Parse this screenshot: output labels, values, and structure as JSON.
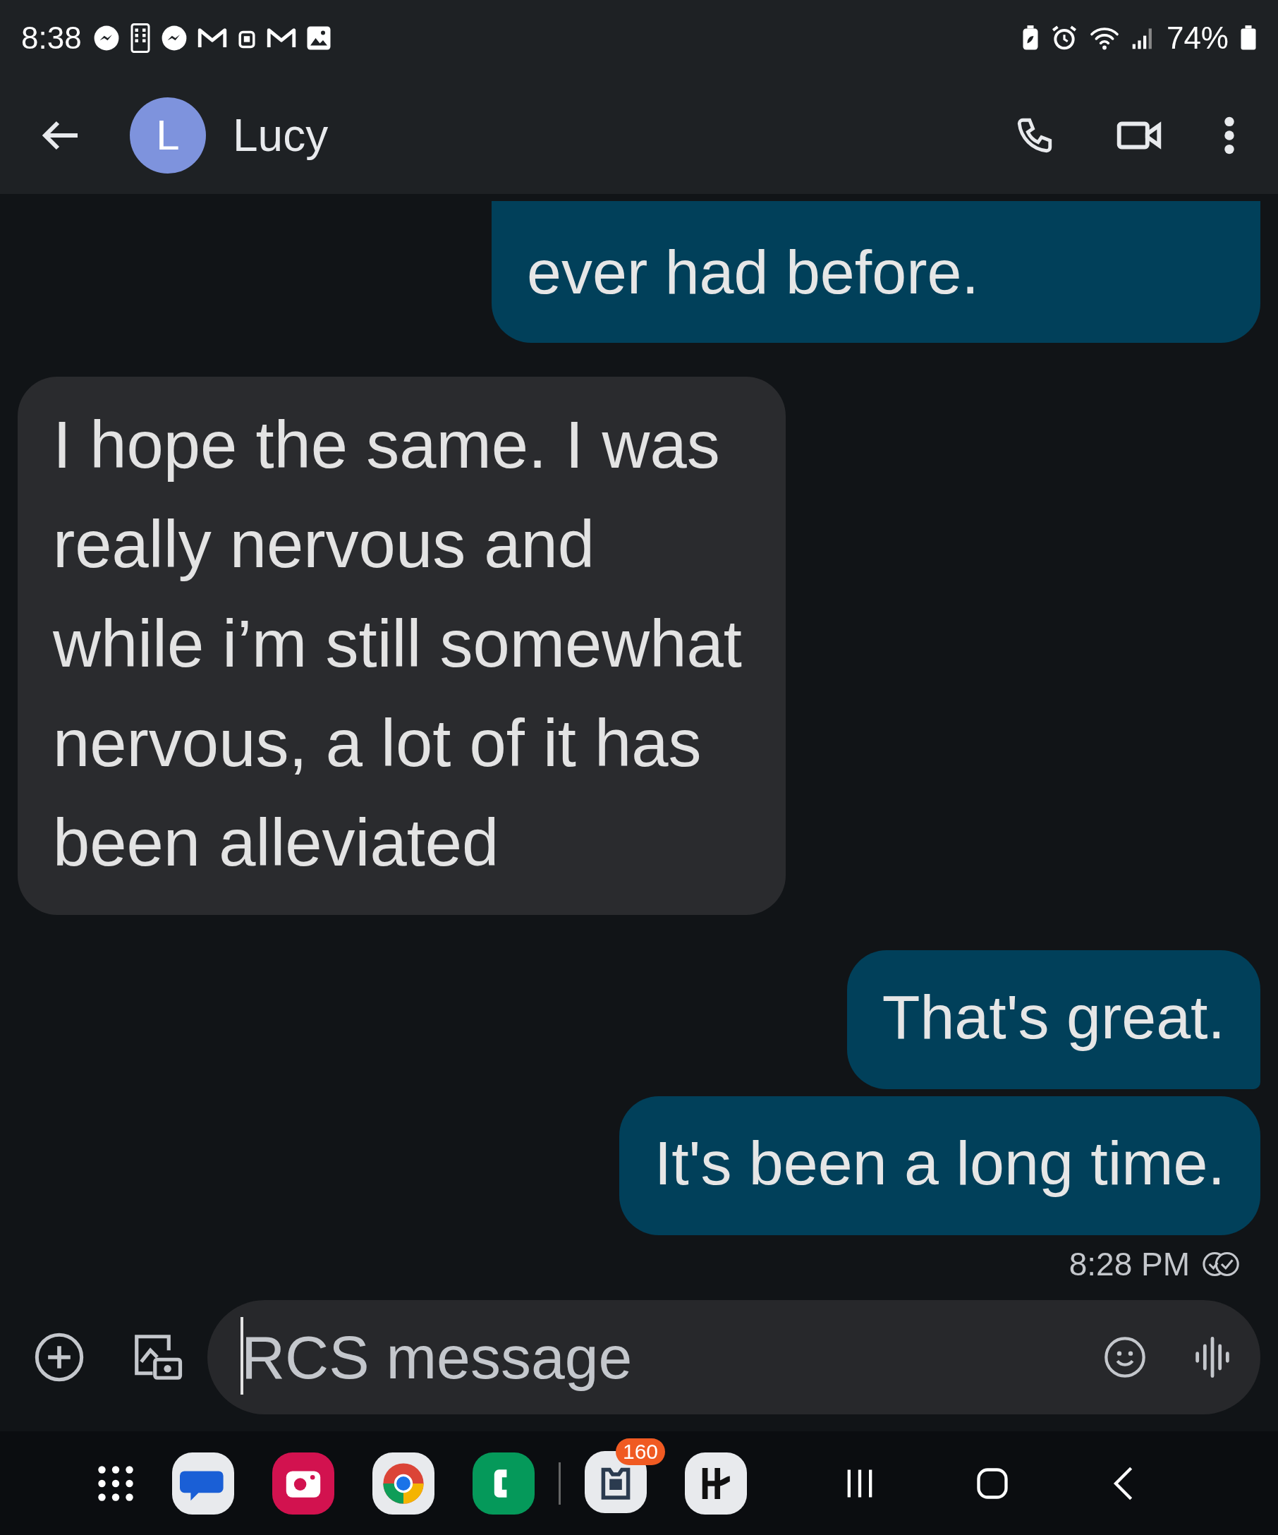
{
  "status_bar": {
    "time": "8:38",
    "battery_percent": "74%"
  },
  "header": {
    "avatar_letter": "L",
    "contact_name": "Lucy"
  },
  "messages": [
    {
      "kind": "sent",
      "text": "ever had before.",
      "cut_top": true
    },
    {
      "kind": "received",
      "text": "I hope the same. I was really nervous and while i’m still somewhat nervous, a lot of it has been alleviated",
      "cut_top": false
    },
    {
      "kind": "sent",
      "text": "That's great.",
      "cut_top": false
    },
    {
      "kind": "sent",
      "text": "It's been a long time.",
      "cut_top": false
    }
  ],
  "timestamp": "8:28 PM",
  "composer": {
    "placeholder": "RCS message"
  },
  "dock": {
    "badge": "160"
  }
}
